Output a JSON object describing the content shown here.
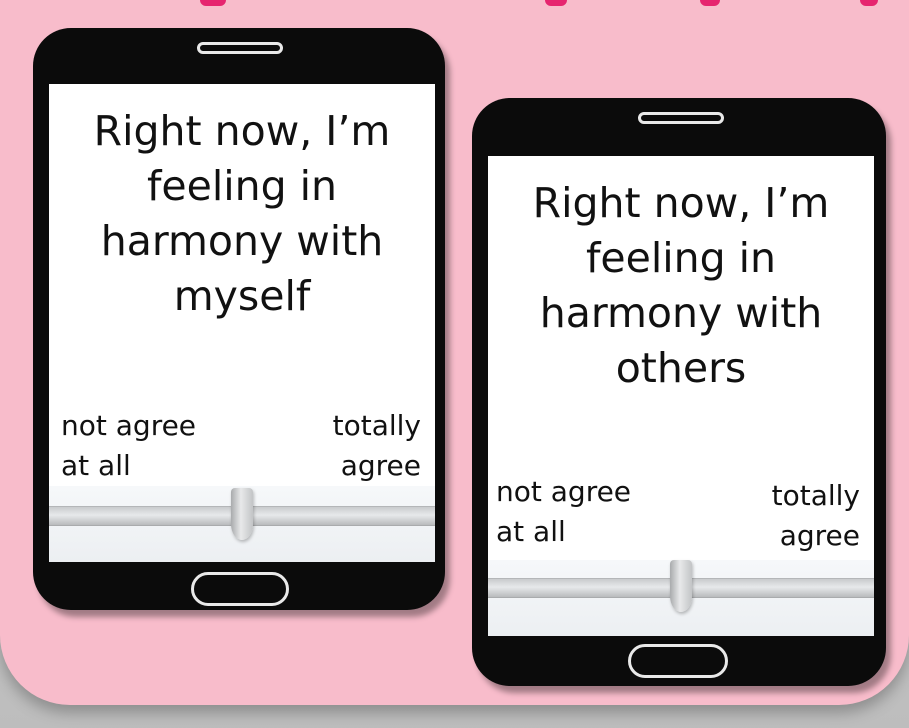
{
  "cards": [
    {
      "statement": "Right now, I’m\nfeeling in\nharmony with\nmyself",
      "scale_low": "not agree\nat all",
      "scale_high": "totally\nagree",
      "slider_value": 0.5
    },
    {
      "statement": "Right now, I’m\nfeeling in\nharmony with\nothers",
      "scale_low": "not agree\nat all",
      "scale_high": "totally\nagree",
      "slider_value": 0.5
    }
  ],
  "colors": {
    "background": "#f8bccb",
    "accent": "#e6246f",
    "phone_body": "#0b0b0b",
    "screen": "#ffffff"
  }
}
